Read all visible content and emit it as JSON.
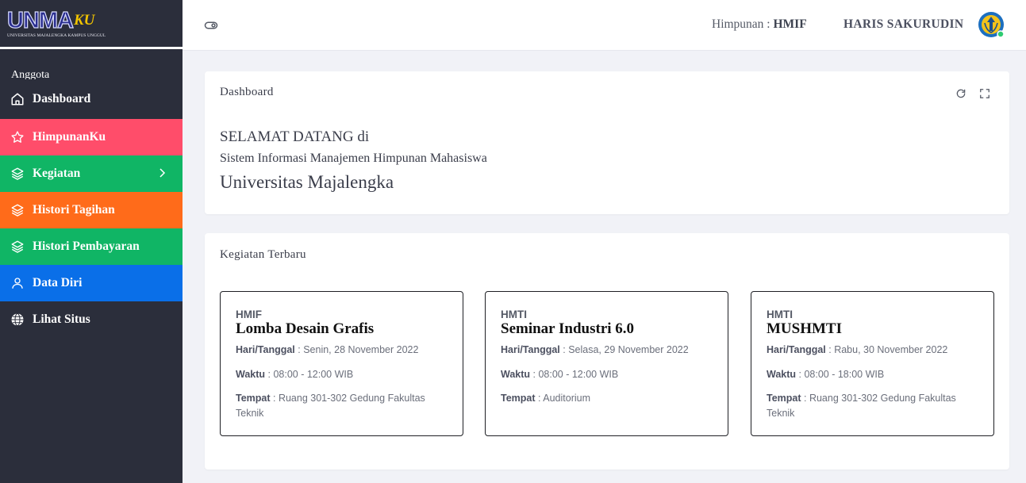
{
  "brand": {
    "logo_main": "UNMA",
    "logo_suffix": "KU",
    "logo_tagline": "UNIVERSITAS MAJALENGKA KAMPUS UNGGUL"
  },
  "sidebar": {
    "section_label": "Anggota",
    "items": [
      {
        "label": "Dashboard",
        "icon": "home-icon",
        "bg": "#2b2e3b"
      },
      {
        "label": "HimpunanKu",
        "icon": "star-icon",
        "bg": "#ff4d6a"
      },
      {
        "label": "Kegiatan",
        "icon": "layers-icon",
        "bg": "#10b565",
        "has_chevron": true
      },
      {
        "label": "Histori Tagihan",
        "icon": "layers-icon",
        "bg": "#ff6b1a"
      },
      {
        "label": "Histori Pembayaran",
        "icon": "layers-icon",
        "bg": "#10b565"
      },
      {
        "label": "Data Diri",
        "icon": "user-icon",
        "bg": "#0a6fe8"
      },
      {
        "label": "Lihat Situs",
        "icon": "globe-icon",
        "bg": "#2b2e3b"
      }
    ]
  },
  "header": {
    "himpunan_label": "Himpunan :",
    "himpunan_value": "HMIF",
    "user_name": "HARIS SAKURUDIN"
  },
  "dashboard_card": {
    "title": "Dashboard",
    "welcome_line1": "SELAMAT DATANG di",
    "welcome_line2": "Sistem Informasi Manajemen Himpunan Mahasiswa",
    "welcome_line3": "Universitas Majalengka"
  },
  "events_card": {
    "title": "Kegiatan Terbaru",
    "labels": {
      "date": "Hari/Tanggal",
      "time": "Waktu",
      "place": "Tempat"
    },
    "events": [
      {
        "org": "HMIF",
        "name": "Lomba Desain Grafis",
        "date": "Senin, 28 November 2022",
        "time": "08:00 - 12:00 WIB",
        "place": "Ruang 301-302 Gedung Fakultas Teknik"
      },
      {
        "org": "HMTI",
        "name": "Seminar Industri 6.0",
        "date": "Selasa, 29 November 2022",
        "time": "08:00 - 12:00 WIB",
        "place": "Auditorium"
      },
      {
        "org": "HMTI",
        "name": "MUSHMTI",
        "date": "Rabu, 30 November 2022",
        "time": "08:00 - 18:00 WIB",
        "place": "Ruang 301-302 Gedung Fakultas Teknik"
      }
    ]
  },
  "colors": {
    "sidebar_bg": "#2b2e3b",
    "page_bg": "#f1f2f7",
    "online_dot": "#2ecc71"
  }
}
